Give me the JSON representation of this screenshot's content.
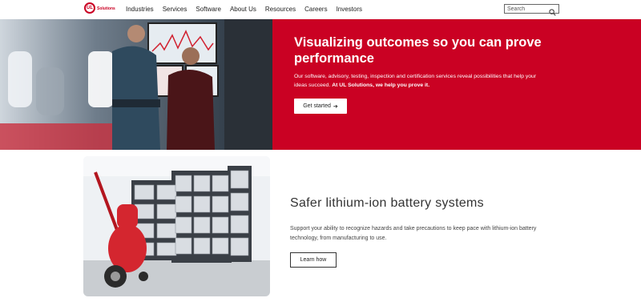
{
  "header": {
    "logo": {
      "mark": "UL",
      "text": "Solutions"
    },
    "nav": [
      "Industries",
      "Services",
      "Software",
      "About Us",
      "Resources",
      "Careers",
      "Investors"
    ],
    "search": {
      "placeholder": "Search",
      "icon": "search-icon"
    }
  },
  "hero": {
    "title": "Visualizing outcomes so you can prove performance",
    "body_plain": "Our software, advisory, testing, inspection and certification services reveal possibilities that help your ideas succeed. ",
    "body_bold": "At UL Solutions, we help you prove it.",
    "button_label": "Get started",
    "button_icon": "arrow-right-icon",
    "accent_color": "#ca0123"
  },
  "feature": {
    "title": "Safer lithium-ion battery systems",
    "body": "Support your ability to recognize hazards and take precautions to keep pace with lithium-ion battery technology, from manufacturing to use.",
    "button_label": "Learn how"
  }
}
